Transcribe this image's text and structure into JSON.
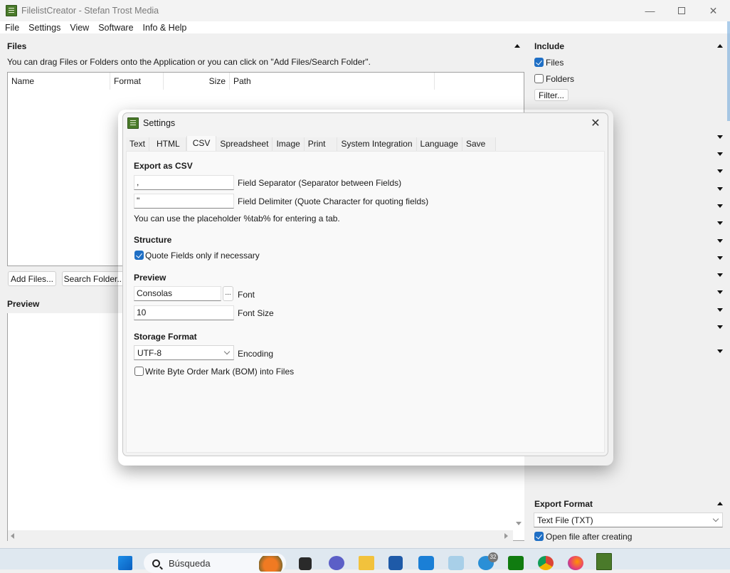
{
  "window": {
    "title": "FilelistCreator - Stefan Trost Media",
    "controls": [
      "minimize",
      "maximize",
      "close"
    ]
  },
  "menu": [
    "File",
    "Settings",
    "View",
    "Software",
    "Info & Help"
  ],
  "files_section": {
    "title": "Files",
    "hint": "You can drag Files or Folders onto the Application or you can click on \"Add Files/Search Folder\".",
    "columns": [
      "Name",
      "Format",
      "",
      "Size",
      "Path"
    ],
    "add_files_label": "Add Files...",
    "search_folder_label": "Search Folder..."
  },
  "preview_section": {
    "title": "Preview"
  },
  "include_section": {
    "title": "Include",
    "files_label": "Files",
    "files_checked": true,
    "folders_label": "Folders",
    "folders_checked": false,
    "filter_label": "Filter..."
  },
  "export_section": {
    "title": "Export Format",
    "format_value": "Text File (TXT)",
    "open_after_label": "Open file after creating",
    "open_after_checked": true
  },
  "settings_dialog": {
    "title": "Settings",
    "close_label": "✕",
    "tabs": [
      "Text",
      "HTML",
      "CSV",
      "Spreadsheet",
      "Image",
      "Print",
      "System Integration",
      "Language",
      "Save"
    ],
    "active_tab": "CSV",
    "export_csv": {
      "title": "Export as CSV",
      "separator_value": ",",
      "separator_label": "Field Separator (Separator between Fields)",
      "delimiter_value": "\"",
      "delimiter_label": "Field Delimiter (Quote Character for quoting fields)",
      "placeholder_hint": "You can use the placeholder %tab% for entering a tab."
    },
    "structure": {
      "title": "Structure",
      "quote_only_label": "Quote Fields only if necessary",
      "quote_only_checked": true
    },
    "preview": {
      "title": "Preview",
      "font_value": "Consolas",
      "font_button": "...",
      "font_label": "Font",
      "font_size_value": "10",
      "font_size_label": "Font Size"
    },
    "storage": {
      "title": "Storage Format",
      "encoding_value": "UTF-8",
      "encoding_label": "Encoding",
      "bom_label": "Write Byte Order Mark (BOM) into Files",
      "bom_checked": false
    }
  },
  "taskbar": {
    "search_placeholder": "Búsqueda",
    "telegram_badge": "32",
    "apps": [
      "start",
      "search",
      "widgets-pumpkin",
      "task-view",
      "teams",
      "file-explorer",
      "microsoft-store",
      "mail",
      "photos",
      "telegram",
      "xbox",
      "chrome",
      "firefox",
      "filelistcreator"
    ]
  }
}
